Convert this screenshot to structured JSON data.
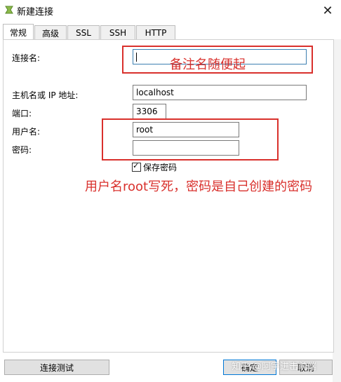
{
  "window": {
    "title": "新建连接"
  },
  "tabs": [
    {
      "label": "常规"
    },
    {
      "label": "高级"
    },
    {
      "label": "SSL"
    },
    {
      "label": "SSH"
    },
    {
      "label": "HTTP"
    }
  ],
  "form": {
    "connection_name_label": "连接名:",
    "connection_name_value": "",
    "host_label": "主机名或 IP 地址:",
    "host_value": "localhost",
    "port_label": "端口:",
    "port_value": "3306",
    "user_label": "用户名:",
    "user_value": "root",
    "password_label": "密码:",
    "password_value": "",
    "save_password_label": "保存密码",
    "save_password_checked": true
  },
  "annotations": {
    "name_hint": "备注名随便起",
    "credentials_hint": "用户名root写死，密码是自己创建的密码",
    "color": "#d9302c"
  },
  "buttons": {
    "test": "连接测试",
    "ok": "确定",
    "cancel": "取消"
  },
  "watermark": "知乎 @阿宇进击前端"
}
